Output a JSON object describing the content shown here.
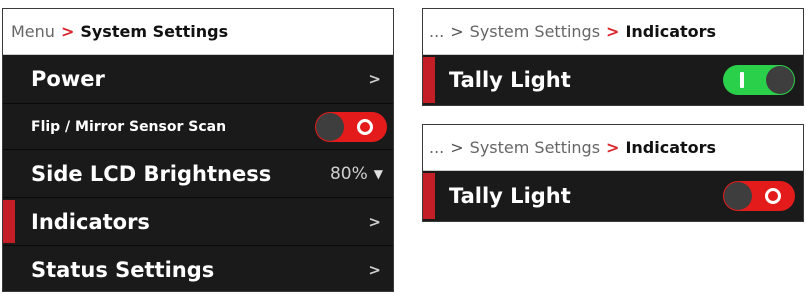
{
  "main_menu": {
    "breadcrumb": {
      "root": "Menu",
      "separator": ">",
      "current": "System Settings"
    },
    "items": [
      {
        "label": "Power",
        "right": ">"
      },
      {
        "label": "Flip / Mirror Sensor Scan",
        "toggle": "off"
      },
      {
        "label": "Side LCD Brightness",
        "value": "80%",
        "caret": "▼"
      },
      {
        "label": "Indicators",
        "right": ">",
        "selected": true
      },
      {
        "label": "Status Settings",
        "right": ">"
      }
    ]
  },
  "indicators_on": {
    "breadcrumb": {
      "ellipsis": "...",
      "separator": ">",
      "parent": "System Settings",
      "current": "Indicators"
    },
    "item": {
      "label": "Tally Light",
      "toggle": "on"
    }
  },
  "indicators_off": {
    "breadcrumb": {
      "ellipsis": "...",
      "separator": ">",
      "parent": "System Settings",
      "current": "Indicators"
    },
    "item": {
      "label": "Tally Light",
      "toggle": "off"
    }
  },
  "colors": {
    "accent_red": "#c41e26",
    "toggle_off": "#e31b1b",
    "toggle_on": "#2bd04a",
    "panel_bg": "#1a1a1a"
  }
}
